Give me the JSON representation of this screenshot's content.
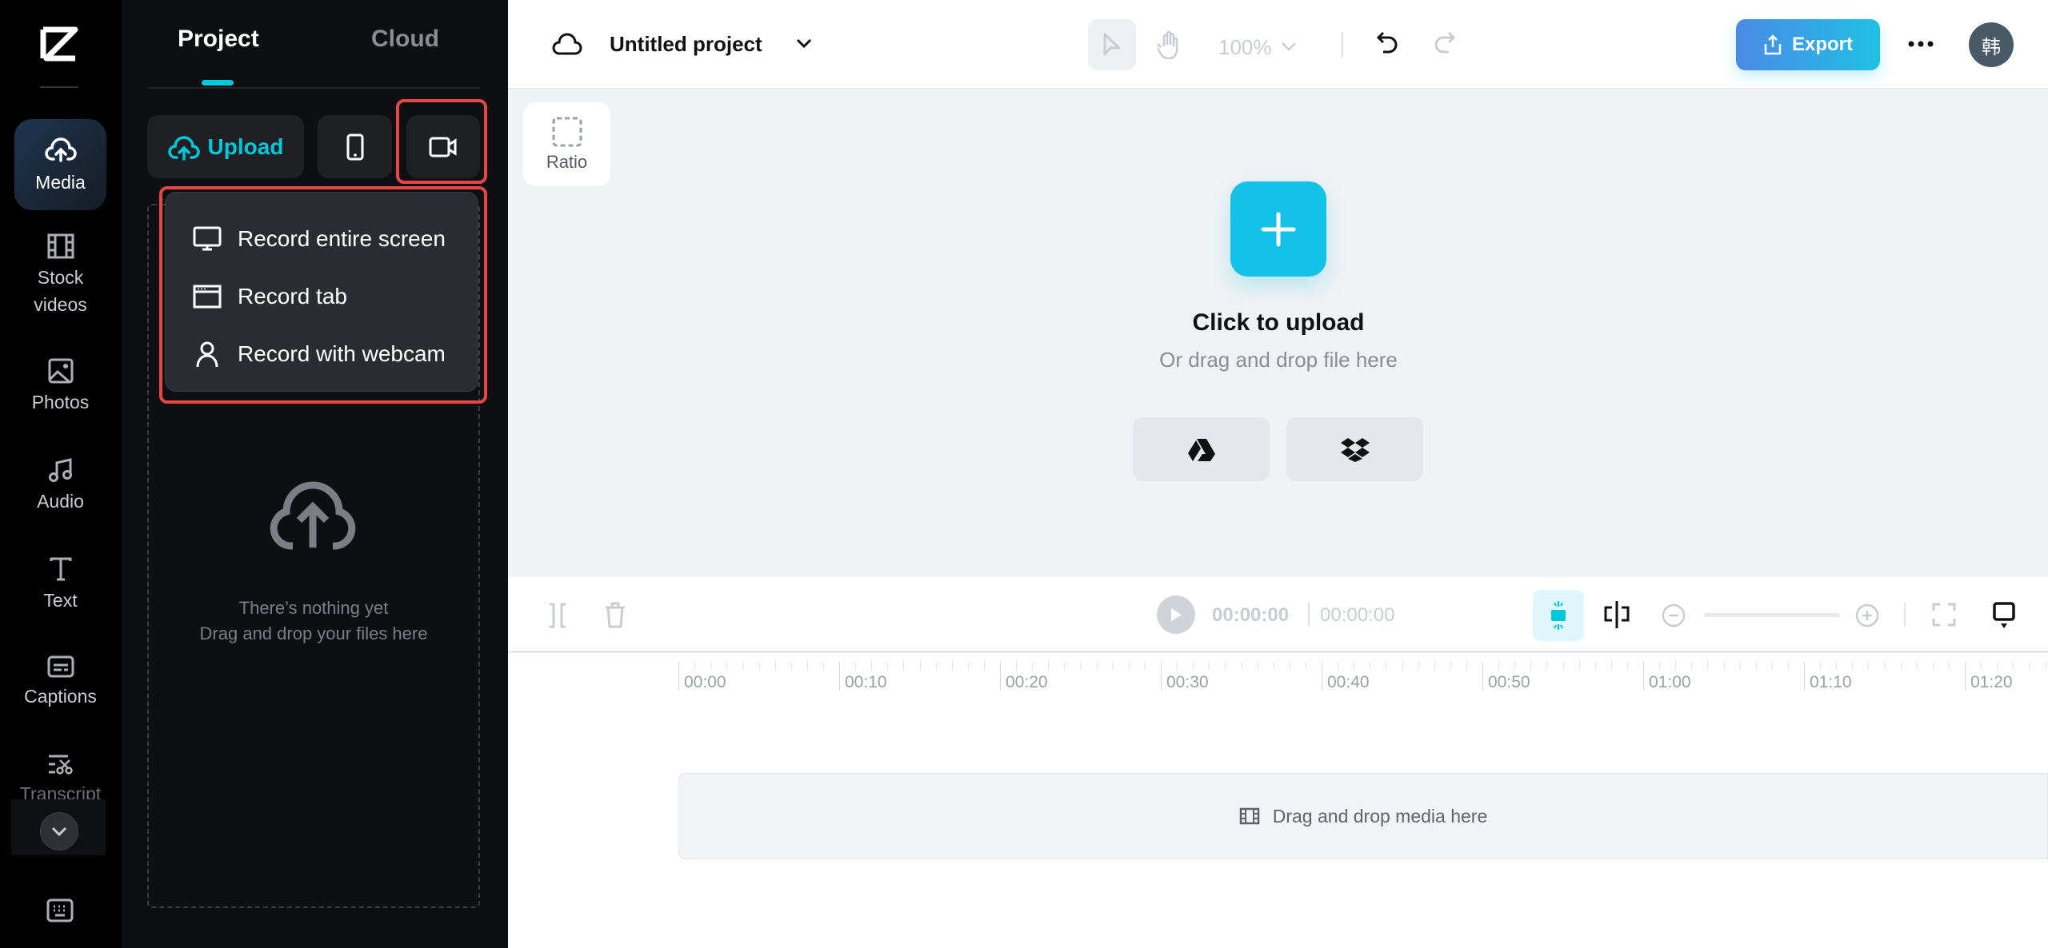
{
  "sidebar": {
    "items": [
      {
        "label": "Media",
        "icon": "cloud-upload-icon",
        "active": true
      },
      {
        "label": "Stock videos",
        "icon": "film-icon"
      },
      {
        "label": "Photos",
        "icon": "image-icon"
      },
      {
        "label": "Audio",
        "icon": "music-note-icon"
      },
      {
        "label": "Text",
        "icon": "text-icon"
      },
      {
        "label": "Captions",
        "icon": "captions-icon"
      },
      {
        "label": "Transcript",
        "icon": "transcript-icon"
      }
    ]
  },
  "panel": {
    "tabs": [
      {
        "label": "Project",
        "active": true
      },
      {
        "label": "Cloud"
      }
    ],
    "upload_label": "Upload",
    "record_menu": {
      "items": [
        {
          "label": "Record entire screen",
          "icon": "monitor-icon"
        },
        {
          "label": "Record tab",
          "icon": "browser-tab-icon"
        },
        {
          "label": "Record with webcam",
          "icon": "person-icon"
        }
      ]
    },
    "empty_title": "There’s nothing yet",
    "empty_subtitle": "Drag and drop your files here"
  },
  "header": {
    "title": "Untitled project",
    "zoom": "100%",
    "export_label": "Export",
    "avatar": "韩"
  },
  "stage": {
    "ratio_label": "Ratio",
    "upload_title": "Click to upload",
    "upload_subtitle": "Or drag and drop file here"
  },
  "timeline": {
    "current_time": "00:00:00",
    "total_time": "00:00:00",
    "ruler": [
      "00:00",
      "00:10",
      "00:20",
      "00:30",
      "00:40",
      "00:50",
      "01:00",
      "01:10",
      "01:20"
    ],
    "drop_text": "Drag and drop media here"
  },
  "colors": {
    "accent": "#00c8dc",
    "export_start": "#4a8ae6",
    "export_end": "#20c0e4",
    "highlight": "#e84545"
  }
}
